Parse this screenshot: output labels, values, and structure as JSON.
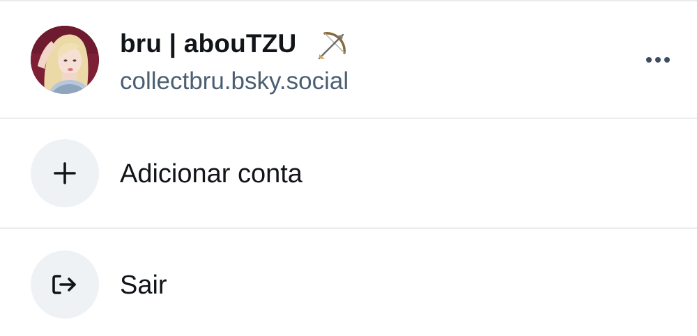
{
  "account": {
    "display_name": "bru | abouTZU",
    "handle": "collectbru.bsky.social",
    "decoration_icon": "bow-and-arrow-icon",
    "menu_icon": "more-horizontal-icon"
  },
  "actions": {
    "add_account": {
      "label": "Adicionar conta",
      "icon": "plus-icon"
    },
    "sign_out": {
      "label": "Sair",
      "icon": "sign-out-icon"
    }
  },
  "colors": {
    "text_primary": "#111418",
    "text_secondary": "#4b5f72",
    "icon_circle_bg": "#eff2f5",
    "divider": "#eaedf0",
    "avatar_bg": "#7d1f35"
  }
}
